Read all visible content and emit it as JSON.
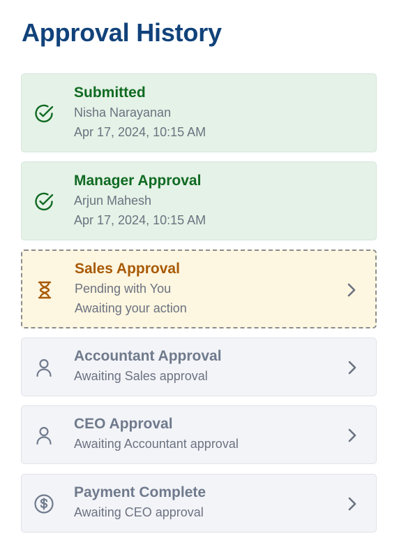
{
  "page": {
    "title": "Approval History"
  },
  "steps": [
    {
      "title": "Submitted",
      "line1": "Nisha Narayanan",
      "line2": "Apr 17, 2024, 10:15 AM",
      "status": "completed",
      "icon": "check-circle-icon"
    },
    {
      "title": "Manager Approval",
      "line1": "Arjun Mahesh",
      "line2": "Apr 17, 2024, 10:15 AM",
      "status": "completed",
      "icon": "check-circle-icon"
    },
    {
      "title": "Sales Approval",
      "line1": "Pending with You",
      "line2": "Awaiting your action",
      "status": "pending",
      "icon": "hourglass-icon"
    },
    {
      "title": "Accountant Approval",
      "line1": "Awaiting Sales approval",
      "status": "waiting",
      "icon": "user-icon"
    },
    {
      "title": "CEO Approval",
      "line1": "Awaiting Accountant approval",
      "status": "waiting",
      "icon": "user-icon"
    },
    {
      "title": "Payment Complete",
      "line1": "Awaiting CEO approval",
      "status": "waiting",
      "icon": "dollar-circle-icon"
    }
  ],
  "colors": {
    "title": "#11427a",
    "completed": "#0f6a22",
    "pending": "#a85a06",
    "waiting": "#6f7a8c",
    "completed_bg": "#e5f2e7",
    "pending_bg": "#fdf6e0",
    "waiting_bg": "#f3f4f8"
  }
}
